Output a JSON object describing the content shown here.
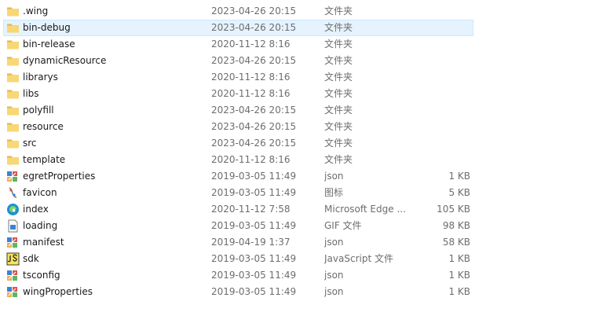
{
  "files": [
    {
      "name": ".wing",
      "date": "2023-04-26 20:15",
      "type": "文件夹",
      "size": "",
      "icon": "folder-icon"
    },
    {
      "name": "bin-debug",
      "date": "2023-04-26 20:15",
      "type": "文件夹",
      "size": "",
      "icon": "folder-icon",
      "selected": true
    },
    {
      "name": "bin-release",
      "date": "2020-11-12 8:16",
      "type": "文件夹",
      "size": "",
      "icon": "folder-icon"
    },
    {
      "name": "dynamicResource",
      "date": "2023-04-26 20:15",
      "type": "文件夹",
      "size": "",
      "icon": "folder-icon"
    },
    {
      "name": "librarys",
      "date": "2020-11-12 8:16",
      "type": "文件夹",
      "size": "",
      "icon": "folder-icon"
    },
    {
      "name": "libs",
      "date": "2020-11-12 8:16",
      "type": "文件夹",
      "size": "",
      "icon": "folder-icon"
    },
    {
      "name": "polyfill",
      "date": "2023-04-26 20:15",
      "type": "文件夹",
      "size": "",
      "icon": "folder-icon"
    },
    {
      "name": "resource",
      "date": "2023-04-26 20:15",
      "type": "文件夹",
      "size": "",
      "icon": "folder-icon"
    },
    {
      "name": "src",
      "date": "2023-04-26 20:15",
      "type": "文件夹",
      "size": "",
      "icon": "folder-icon"
    },
    {
      "name": "template",
      "date": "2020-11-12 8:16",
      "type": "文件夹",
      "size": "",
      "icon": "folder-icon"
    },
    {
      "name": "egretProperties",
      "date": "2019-03-05 11:49",
      "type": "json",
      "size": "1 KB",
      "icon": "json-file-icon"
    },
    {
      "name": "favicon",
      "date": "2019-03-05 11:49",
      "type": "图标",
      "size": "5 KB",
      "icon": "ico-file-icon"
    },
    {
      "name": "index",
      "date": "2020-11-12 7:58",
      "type": "Microsoft Edge ...",
      "size": "105 KB",
      "icon": "edge-html-icon"
    },
    {
      "name": "loading",
      "date": "2019-03-05 11:49",
      "type": "GIF 文件",
      "size": "98 KB",
      "icon": "gif-file-icon"
    },
    {
      "name": "manifest",
      "date": "2019-04-19 1:37",
      "type": "json",
      "size": "58 KB",
      "icon": "json-file-icon"
    },
    {
      "name": "sdk",
      "date": "2019-03-05 11:49",
      "type": "JavaScript 文件",
      "size": "1 KB",
      "icon": "js-file-icon"
    },
    {
      "name": "tsconfig",
      "date": "2019-03-05 11:49",
      "type": "json",
      "size": "1 KB",
      "icon": "json-file-icon"
    },
    {
      "name": "wingProperties",
      "date": "2019-03-05 11:49",
      "type": "json",
      "size": "1 KB",
      "icon": "json-file-icon"
    }
  ],
  "colors": {
    "folder": "#f8d775",
    "folder_dark": "#e6b543",
    "selection_bg": "#e5f3ff",
    "secondary_text": "#6d6d6d"
  }
}
